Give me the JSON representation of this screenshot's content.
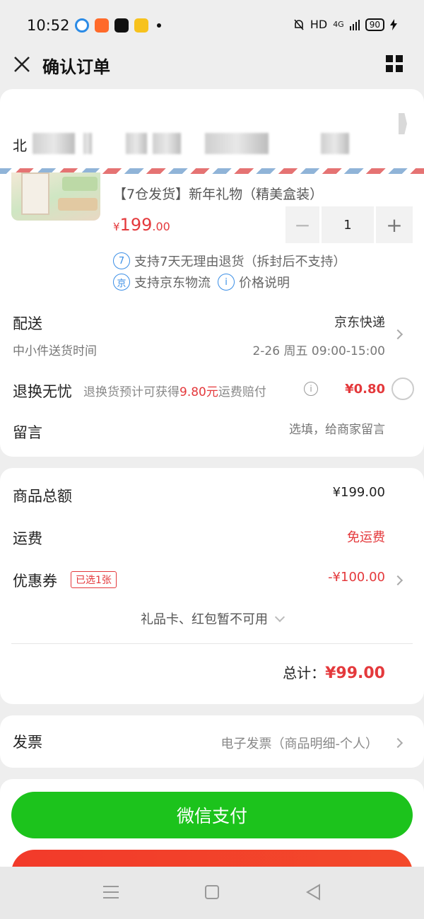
{
  "status_bar": {
    "time": "10:52",
    "hd": "HD",
    "network": "4G",
    "battery": "90"
  },
  "nav": {
    "title": "确认订单"
  },
  "address": {
    "visible_start": "北"
  },
  "product": {
    "name": "【7仓发货】新年礼物（精美盒装）",
    "price_currency": "¥",
    "price_int": "199",
    "price_dec": ".00",
    "quantity": "1",
    "feature_return_icon": "7",
    "feature_return": "支持7天无理由退货（拆封后不支持）",
    "feature_jd_icon": "京",
    "feature_jd": "支持京东物流",
    "feature_price_icon": "i",
    "feature_price": "价格说明"
  },
  "delivery": {
    "title": "配送",
    "method": "京东快递",
    "subtitle": "中小件送货时间",
    "time": "2-26 周五 09:00-15:00"
  },
  "return_worry_free": {
    "title": "退换无忧",
    "desc_prefix": "退换货预计可获得",
    "desc_highlight": "9.80元",
    "desc_suffix": "运费赔付",
    "price": "¥0.80"
  },
  "message": {
    "title": "留言",
    "placeholder": "选填，给商家留言"
  },
  "amounts": {
    "goods_total_label": "商品总额",
    "goods_total_value": "¥199.00",
    "shipping_label": "运费",
    "shipping_value": "免运费",
    "coupon_label": "优惠券",
    "coupon_badge": "已选1张",
    "coupon_value": "-¥100.00",
    "gift_card_note": "礼品卡、红包暂不可用",
    "total_label": "总计：",
    "total_value": "¥99.00"
  },
  "invoice": {
    "title": "发票",
    "value": "电子发票（商品明细-个人）"
  },
  "payment": {
    "wechat_label": "微信支付"
  },
  "colors": {
    "accent_red": "#e4393c",
    "wechat_green": "#1cc31c",
    "link_blue": "#3a8ee6"
  }
}
